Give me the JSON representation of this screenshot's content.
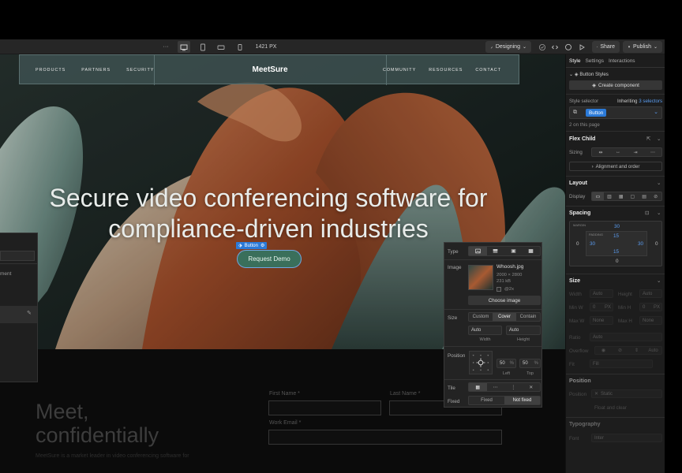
{
  "toolbar": {
    "more": "···",
    "width_readout": "1421 PX",
    "mode_label": "Designing",
    "share_label": "Share",
    "publish_label": "Publish"
  },
  "site": {
    "nav_left": [
      "PRODUCTS",
      "PARTNERS",
      "SECURITY"
    ],
    "logo": "MeetSure",
    "nav_right": [
      "COMMUNITY",
      "RESOURCES",
      "CONTACT"
    ],
    "headline_line1": "Secure video conferencing software for",
    "headline_line2": "compliance-driven industries",
    "cta_label": "Request Demo",
    "badge_label": "Button",
    "meet_line1": "Meet,",
    "meet_line2": "confidentially",
    "meet_sub": "MeetSure is a market leader in video conferencing software for",
    "form": {
      "first_name": "First Name *",
      "last_name": "Last Name  *",
      "work_email": "Work Email *"
    }
  },
  "left_panel": {
    "frag": "ment"
  },
  "image_panel": {
    "type_label": "Type",
    "image_label": "Image",
    "file_name": "Whoosh.jpg",
    "dimensions": "2000 × 2800",
    "file_size": "231 kB",
    "retina": "@2x",
    "choose_image": "Choose image",
    "size_label": "Size",
    "size_options": [
      "Custom",
      "Cover",
      "Contain"
    ],
    "size_selected": "Cover",
    "width_value": "Auto",
    "height_value": "Auto",
    "width_caption": "Width",
    "height_caption": "Height",
    "position_label": "Position",
    "left_value": "50",
    "top_value": "50",
    "pct": "%",
    "left_caption": "Left",
    "top_caption": "Top",
    "tile_label": "Tile",
    "fixed_label": "Fixed",
    "fixed_options": [
      "Fixed",
      "Not fixed"
    ],
    "fixed_selected": "Not fixed"
  },
  "right_panel": {
    "tabs": [
      "Style",
      "Settings",
      "Interactions"
    ],
    "active_tab": "Style",
    "button_styles": "Button Styles",
    "create_component": "Create component",
    "style_selector": "Style selector",
    "inheriting": "Inheriting",
    "selectors": "3 selectors",
    "selector_chip": "Button",
    "on_page": "2 on this page",
    "flex_child": "Flex Child",
    "sizing": "Sizing",
    "alignment_order": "Alignment and order",
    "layout": "Layout",
    "display": "Display",
    "spacing": "Spacing",
    "margin_label": "MARGIN",
    "padding_label": "PADDING",
    "margin": {
      "top": "30",
      "right": "0",
      "bottom": "0",
      "left": "0"
    },
    "padding": {
      "top": "15",
      "right": "30",
      "bottom": "15",
      "left": "30"
    },
    "size": "Size",
    "width_label": "Width",
    "width_value": "Auto",
    "height_label": "Height",
    "height_value": "Auto",
    "min_w": "Min W",
    "min_w_value": "0",
    "min_h": "Min H",
    "min_h_value": "0",
    "px": "PX",
    "max_w": "Max W",
    "max_w_value": "None",
    "max_h": "Max H",
    "max_h_value": "None",
    "ratio": "Ratio",
    "ratio_value": "Auto",
    "overflow": "Overflow",
    "overflow_value": "Auto",
    "fit": "Fit",
    "fit_value": "Fill",
    "position": "Position",
    "position_label": "Position",
    "position_value": "Static",
    "float_clear": "Float and clear",
    "typography": "Typography",
    "font": "Font",
    "font_value": "Inter"
  },
  "colors": {
    "accent_blue": "#2b7ad8",
    "cta_green": "#3a6f5b",
    "panel_bg": "#1d1d1d",
    "nav_bg": "#3e5252"
  }
}
